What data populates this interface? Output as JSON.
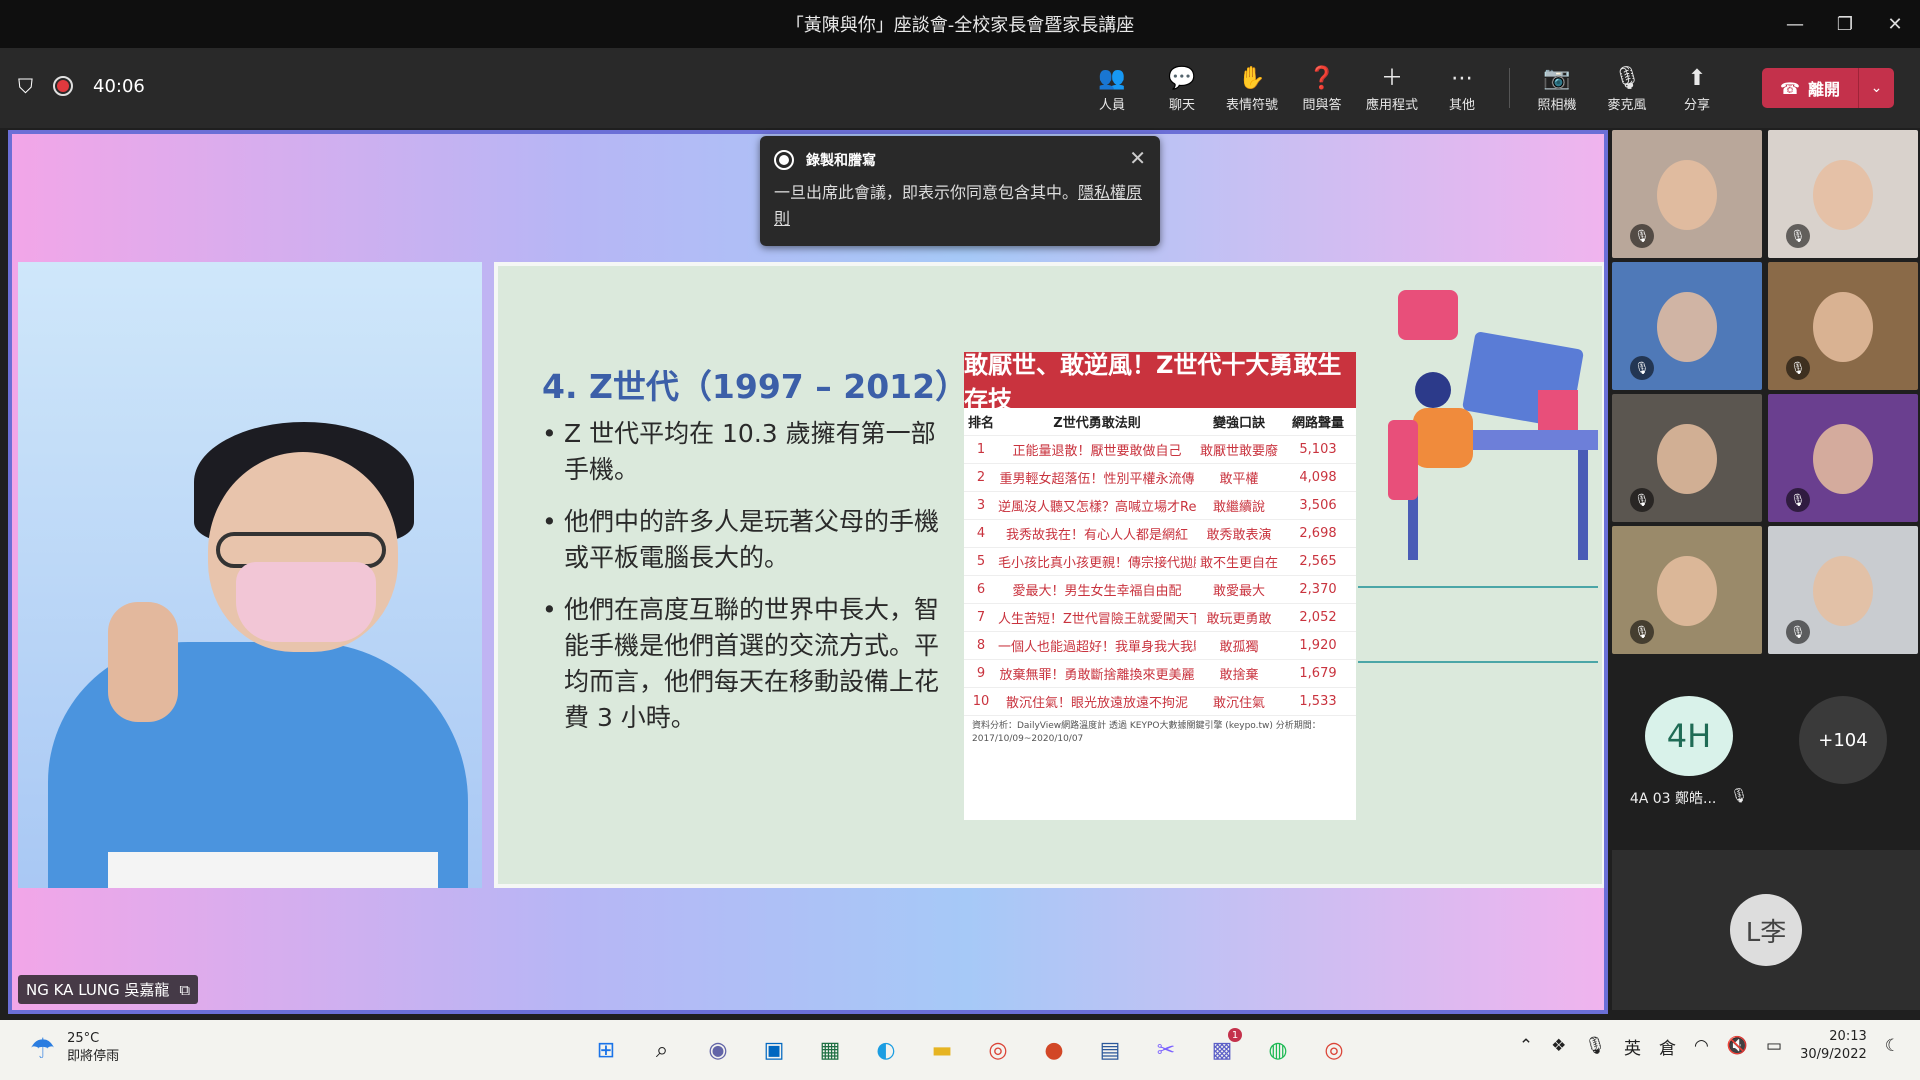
{
  "window": {
    "title": "「黃陳與你」座談會-全校家長會暨家長講座",
    "minimize": "—",
    "restore": "❐",
    "close": "✕"
  },
  "toolbar": {
    "timer": "40:06",
    "buttons": [
      {
        "label": "人員",
        "icon": "people-icon",
        "glyph": "👥"
      },
      {
        "label": "聊天",
        "icon": "chat-icon",
        "glyph": "💬"
      },
      {
        "label": "表情符號",
        "icon": "emoji-icon",
        "glyph": "✋"
      },
      {
        "label": "問與答",
        "icon": "qa-icon",
        "glyph": "❓"
      },
      {
        "label": "應用程式",
        "icon": "plus-icon",
        "glyph": "＋"
      },
      {
        "label": "其他",
        "icon": "more-icon",
        "glyph": "⋯"
      }
    ],
    "av_buttons": [
      {
        "label": "照相機",
        "icon": "camera-off-icon",
        "glyph": "📷"
      },
      {
        "label": "麥克風",
        "icon": "mic-off-icon",
        "glyph": "🎙"
      },
      {
        "label": "分享",
        "icon": "share-icon",
        "glyph": "⬆"
      }
    ],
    "leave_label": "離開",
    "leave_glyph": "☎",
    "leave_dropdown": "⌄"
  },
  "banner": {
    "title": "錄製和謄寫",
    "body": "一旦出席此會議，即表示你同意包含其中。",
    "link": "隱私權原則",
    "close": "✕"
  },
  "speaker": {
    "name": "NG KA LUNG 吳嘉龍",
    "badge": "⧉"
  },
  "slide": {
    "title": "4. Z世代（1997 – 2012）:",
    "bullets": [
      "Z 世代平均在 10.3 歲擁有第一部手機。",
      "他們中的許多人是玩著父母的手機或平板電腦長大的。",
      "他們在高度互聯的世界中長大，智能手機是他們首選的交流方式。平均而言，他們每天在移動設備上花費 3 小時。"
    ],
    "table": {
      "heading": "敢厭世、敢逆風！Z世代十大勇敢生存技",
      "columns": [
        "排名",
        "Z世代勇敢法則",
        "變強口訣",
        "網路聲量"
      ],
      "rows": [
        [
          "1",
          "正能量退散！厭世要敢做自己",
          "敢厭世敢要廢",
          "5,103"
        ],
        [
          "2",
          "重男輕女超落伍！性別平權永流傳",
          "敢平權",
          "4,098"
        ],
        [
          "3",
          "逆風沒人聽又怎樣？高喊立場才Real",
          "敢繼續說",
          "3,506"
        ],
        [
          "4",
          "我秀故我在！有心人人都是網紅",
          "敢秀敢表演",
          "2,698"
        ],
        [
          "5",
          "毛小孩比真小孩更親！傳宗接代拋腦後",
          "敢不生更自在",
          "2,565"
        ],
        [
          "6",
          "愛最大！男生女生幸福自由配",
          "敢愛最大",
          "2,370"
        ],
        [
          "7",
          "人生苦短！Z世代冒險王就愛闖天下",
          "敢玩更勇敢",
          "2,052"
        ],
        [
          "8",
          "一個人也能過超好！我單身我大我驕傲",
          "敢孤獨",
          "1,920"
        ],
        [
          "9",
          "放棄無罪！勇敢斷捨離換來更美麗",
          "敢捨棄",
          "1,679"
        ],
        [
          "10",
          "散沉住氣！眼光放遠放遠不拘泥",
          "敢沉住氣",
          "1,533"
        ]
      ],
      "note": "資料分析：DailyView網路溫度計 透過 KEYPO大數據關鍵引擎 (keypo.tw) 分析期間：2017/10/09~2020/10/07"
    }
  },
  "participants": {
    "tiles": [
      {
        "name": "participant-1",
        "bg": "#b9a79a"
      },
      {
        "name": "participant-2",
        "bg": "#d9d2cc"
      },
      {
        "name": "participant-3",
        "bg": "#4f79b8"
      },
      {
        "name": "participant-4",
        "bg": "#8a6a48"
      },
      {
        "name": "participant-5",
        "bg": "#5b5650"
      },
      {
        "name": "participant-6",
        "bg": "#6a3f8f"
      },
      {
        "name": "participant-7",
        "bg": "#9a8a6a"
      },
      {
        "name": "participant-8",
        "bg": "#c9ccd0"
      }
    ],
    "avatar_4h": {
      "initials": "4H",
      "name": "4A 03 鄭皓...",
      "bg": "#d9f2ea",
      "fg": "#1f6b55"
    },
    "overflow": {
      "label": "+104",
      "bg": "#3a3a3a"
    },
    "self_initials": "L李"
  },
  "taskbar": {
    "weather_temp": "25°C",
    "weather_desc": "即將停雨",
    "time": "20:13",
    "date": "30/9/2022",
    "ime": "英",
    "ime2": "倉",
    "teams_badge": "1"
  }
}
